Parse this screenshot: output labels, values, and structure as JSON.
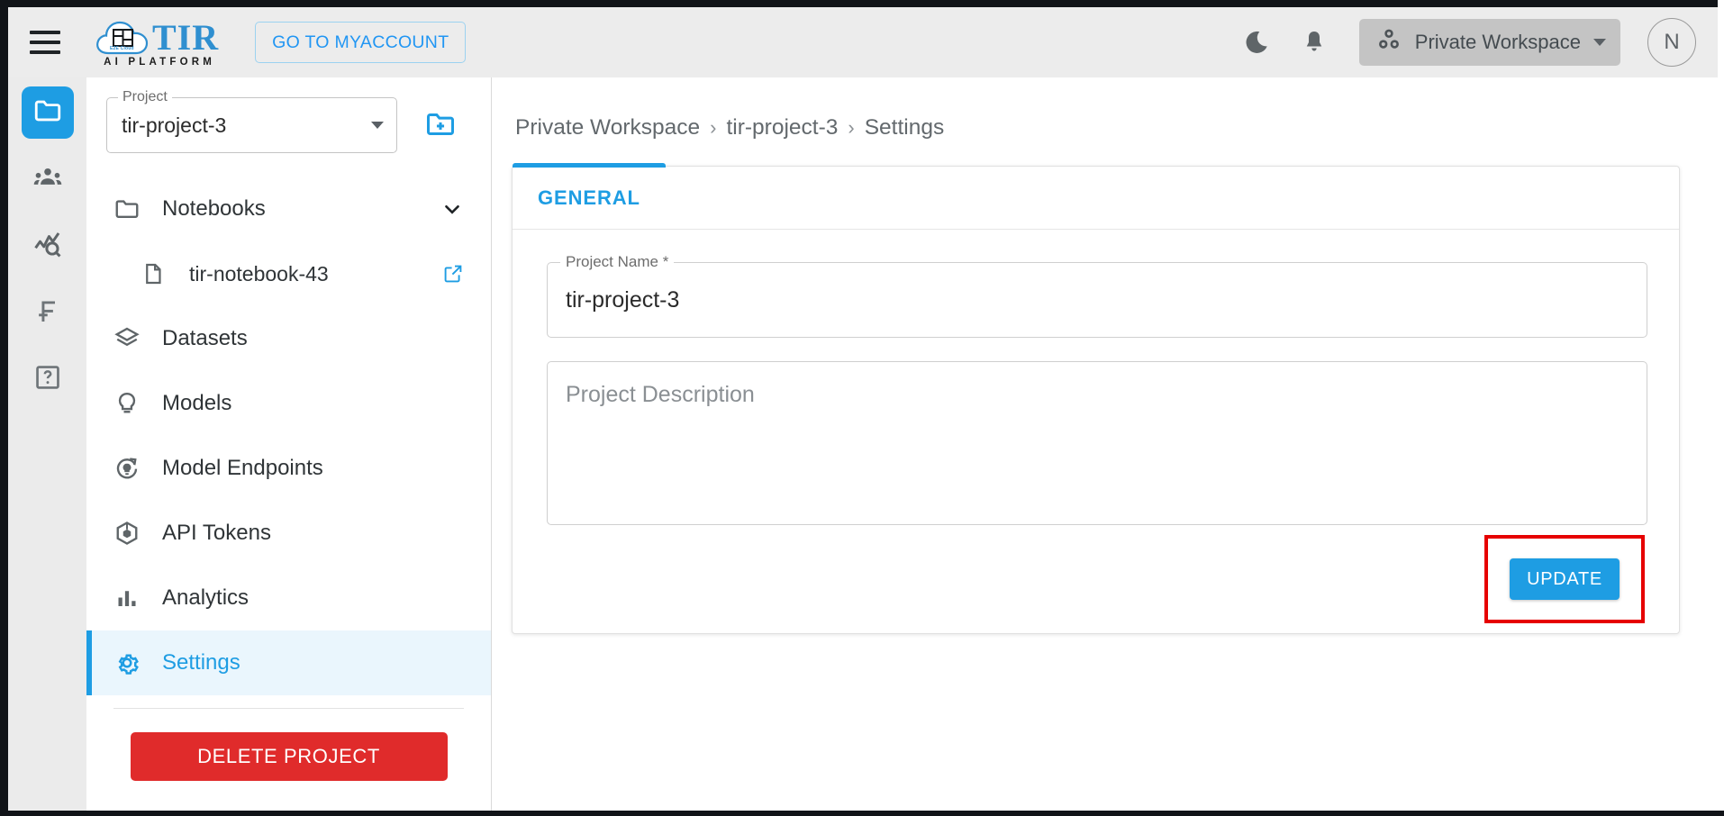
{
  "window": {
    "frame_color": "#111418"
  },
  "appbar": {
    "menu_icon": "hamburger-icon",
    "logo": {
      "text": "TIR",
      "subtitle": "AI PLATFORM",
      "badge_text": "E2E Cloud"
    },
    "myaccount_label": "GO TO MYACCOUNT",
    "dark_mode_icon": "moon-icon",
    "notifications_icon": "bell-icon",
    "workspace": {
      "label": "Private Workspace",
      "icon": "nodes-icon",
      "caret": "chevron-down-icon"
    },
    "avatar_initial": "N"
  },
  "rail": {
    "items": [
      {
        "name": "projects",
        "icon": "folder-icon",
        "active": true
      },
      {
        "name": "teams",
        "icon": "people-group-icon",
        "active": false
      },
      {
        "name": "monitoring",
        "icon": "chart-search-icon",
        "active": false
      },
      {
        "name": "functions",
        "icon": "function-f-icon",
        "active": false
      },
      {
        "name": "help",
        "icon": "question-box-icon",
        "active": false
      }
    ]
  },
  "sidebar": {
    "project_field": {
      "legend": "Project",
      "value": "tir-project-3"
    },
    "new_project_icon": "folder-plus-icon",
    "nav": [
      {
        "label": "Notebooks",
        "icon": "folder-icon",
        "right_icon": "chevron-down-icon",
        "child": false,
        "selected": false
      },
      {
        "label": "tir-notebook-43",
        "icon": "document-icon",
        "right_icon": "external-link-icon",
        "child": true,
        "selected": false
      },
      {
        "label": "Datasets",
        "icon": "layers-icon",
        "right_icon": "",
        "child": false,
        "selected": false
      },
      {
        "label": "Models",
        "icon": "lightbulb-icon",
        "right_icon": "",
        "child": false,
        "selected": false
      },
      {
        "label": "Model Endpoints",
        "icon": "endpoint-refresh-icon",
        "right_icon": "",
        "child": false,
        "selected": false
      },
      {
        "label": "API Tokens",
        "icon": "cube-icon",
        "right_icon": "",
        "child": false,
        "selected": false
      },
      {
        "label": "Analytics",
        "icon": "bar-chart-icon",
        "right_icon": "",
        "child": false,
        "selected": false
      },
      {
        "label": "Settings",
        "icon": "gear-icon",
        "right_icon": "",
        "child": false,
        "selected": true
      }
    ],
    "delete_label": "DELETE PROJECT"
  },
  "main": {
    "breadcrumb": [
      "Private Workspace",
      "tir-project-3",
      "Settings"
    ],
    "breadcrumb_separator": "›",
    "tabs": [
      {
        "label": "GENERAL",
        "active": true
      }
    ],
    "project_name": {
      "legend": "Project Name *",
      "value": "tir-project-3",
      "placeholder": "Project Name"
    },
    "project_description": {
      "value": "",
      "placeholder": "Project Description"
    },
    "update_label": "UPDATE"
  },
  "annotation": {
    "type": "highlight-rectangle",
    "color": "#e60000",
    "target": "update-button"
  },
  "colors": {
    "accent": "#1e9de3",
    "danger": "#e02b2b",
    "appbar_bg": "#ececec",
    "rail_bg": "#ebebeb",
    "selected_bg": "#eaf6fd",
    "annotation": "#e60000"
  }
}
